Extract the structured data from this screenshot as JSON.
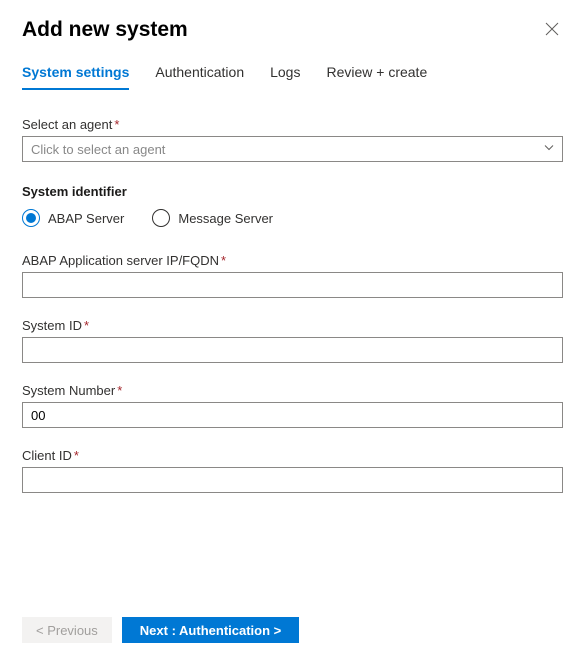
{
  "header": {
    "title": "Add new system"
  },
  "tabs": [
    {
      "label": "System settings",
      "active": true
    },
    {
      "label": "Authentication",
      "active": false
    },
    {
      "label": "Logs",
      "active": false
    },
    {
      "label": "Review + create",
      "active": false
    }
  ],
  "agent": {
    "label": "Select an agent",
    "placeholder": "Click to select an agent"
  },
  "system_identifier": {
    "heading": "System identifier",
    "options": [
      {
        "label": "ABAP Server",
        "checked": true
      },
      {
        "label": "Message Server",
        "checked": false
      }
    ]
  },
  "fields": {
    "abap_server": {
      "label": "ABAP Application server IP/FQDN",
      "value": ""
    },
    "system_id": {
      "label": "System ID",
      "value": ""
    },
    "system_number": {
      "label": "System Number",
      "value": "00"
    },
    "client_id": {
      "label": "Client ID",
      "value": ""
    }
  },
  "footer": {
    "previous": "< Previous",
    "next": "Next : Authentication  >"
  }
}
